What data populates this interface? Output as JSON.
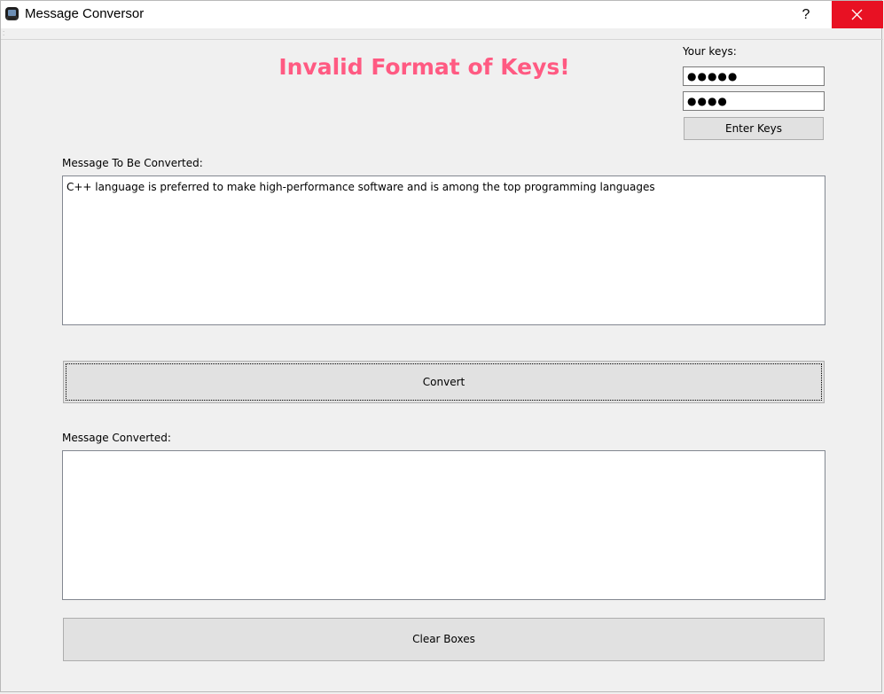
{
  "window": {
    "title": "Message Conversor",
    "help_label": "?",
    "close_icon": "close-icon",
    "app_icon": "app-icon"
  },
  "status": {
    "message": "Invalid Format of Keys!",
    "color": "#ff5a82"
  },
  "keys": {
    "label": "Your keys:",
    "key1_masked": "●●●●●",
    "key2_masked": "●●●●",
    "enter_label": "Enter Keys"
  },
  "input": {
    "label": "Message To Be Converted:",
    "value": "C++ language is preferred to make high-performance software and is among the top programming languages"
  },
  "convert": {
    "label": "Convert"
  },
  "output": {
    "label": "Message Converted:",
    "value": ""
  },
  "clear": {
    "label": "Clear Boxes"
  }
}
